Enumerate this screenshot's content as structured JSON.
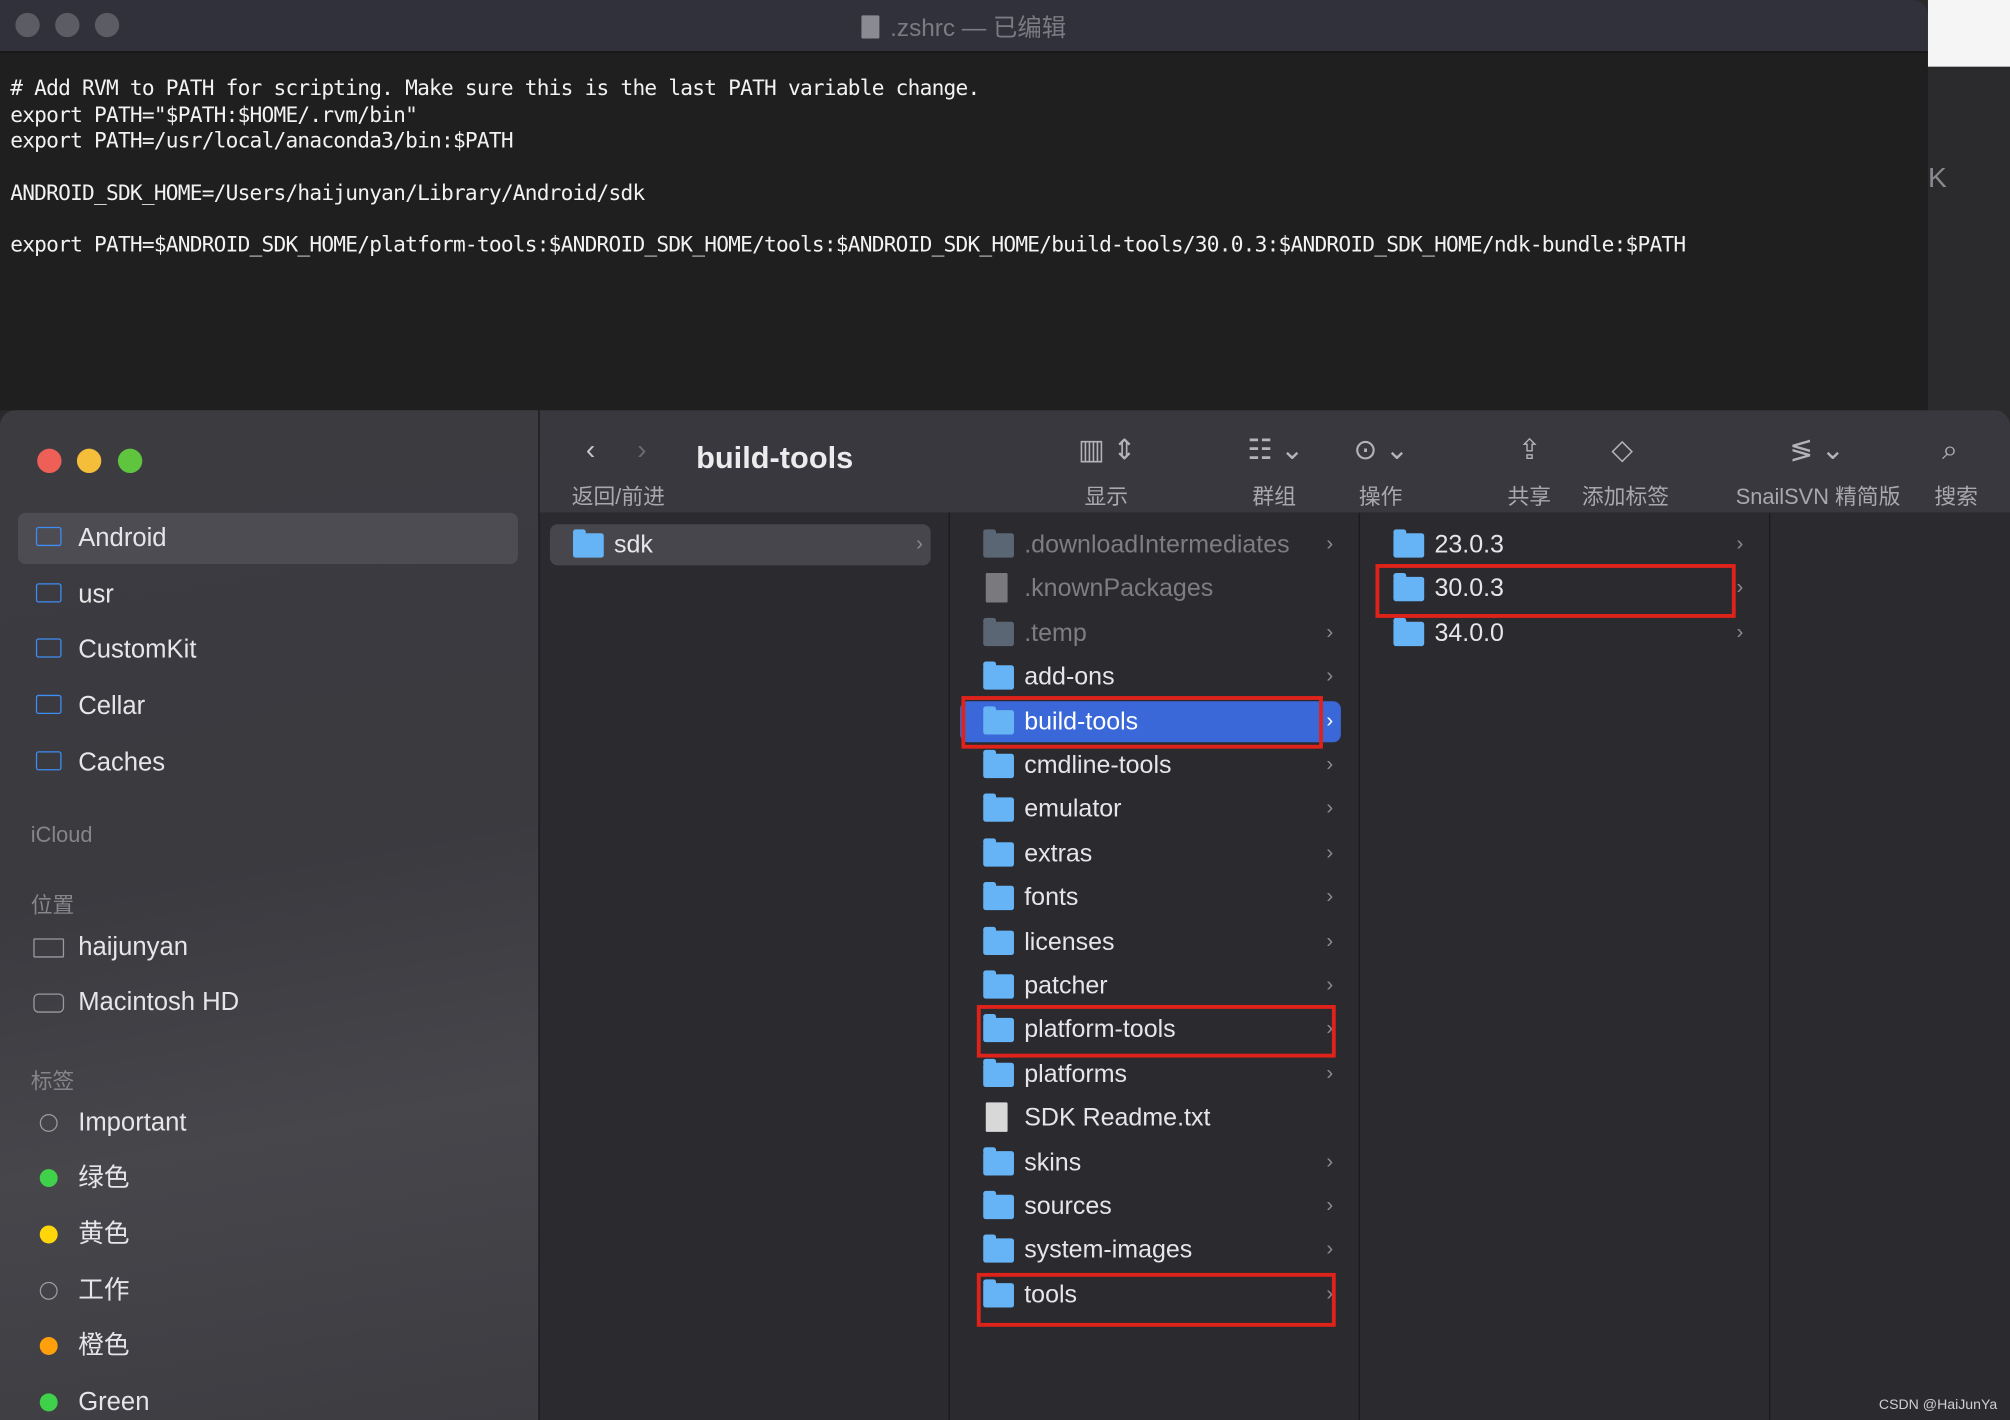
{
  "editor": {
    "title": ".zshrc",
    "title_status": "— 已编辑",
    "lines": [
      "# Add RVM to PATH for scripting. Make sure this is the last PATH variable change.",
      "export PATH=\"$PATH:$HOME/.rvm/bin\"",
      "export PATH=/usr/local/anaconda3/bin:$PATH",
      "ANDROID_SDK_HOME=/Users/haijunyan/Library/Android/sdk",
      "export PATH=$ANDROID_SDK_HOME/platform-tools:$ANDROID_SDK_HOME/tools:$ANDROID_SDK_HOME/build-tools/30.0.3:$ANDROID_SDK_HOME/ndk-bundle:$PATH"
    ],
    "background_fragment": "K"
  },
  "finder": {
    "toolbar": {
      "title": "build-tools",
      "back_forward_label": "返回/前进",
      "view_label": "显示",
      "group_label": "群组",
      "action_label": "操作",
      "share_label": "共享",
      "tag_label": "添加标签",
      "svn_label": "SnailSVN 精简版",
      "search_label": "搜索"
    },
    "sidebar": {
      "favorites": [
        "Android",
        "usr",
        "CustomKit",
        "Cellar",
        "Caches"
      ],
      "selected": "Android",
      "icloud_heading": "iCloud",
      "locations_heading": "位置",
      "locations": [
        "haijunyan",
        "Macintosh HD"
      ],
      "tags_heading": "标签",
      "tags": [
        {
          "label": "Important",
          "color": ""
        },
        {
          "label": "绿色",
          "color": "#3fd14a"
        },
        {
          "label": "黄色",
          "color": "#ffd60a"
        },
        {
          "label": "工作",
          "color": ""
        },
        {
          "label": "橙色",
          "color": "#ff9f0a"
        },
        {
          "label": "Green",
          "color": "#3fd14a"
        }
      ]
    },
    "columns": [
      [
        {
          "name": "sdk",
          "type": "folder",
          "state": "path"
        }
      ],
      [
        {
          "name": ".downloadIntermediates",
          "type": "folder",
          "hidden": true
        },
        {
          "name": ".knownPackages",
          "type": "file",
          "hidden": true
        },
        {
          "name": ".temp",
          "type": "folder",
          "hidden": true
        },
        {
          "name": "add-ons",
          "type": "folder"
        },
        {
          "name": "build-tools",
          "type": "folder",
          "state": "selected",
          "highlighted": true
        },
        {
          "name": "cmdline-tools",
          "type": "folder"
        },
        {
          "name": "emulator",
          "type": "folder"
        },
        {
          "name": "extras",
          "type": "folder"
        },
        {
          "name": "fonts",
          "type": "folder"
        },
        {
          "name": "licenses",
          "type": "folder"
        },
        {
          "name": "patcher",
          "type": "folder"
        },
        {
          "name": "platform-tools",
          "type": "folder",
          "highlighted": true
        },
        {
          "name": "platforms",
          "type": "folder"
        },
        {
          "name": "SDK Readme.txt",
          "type": "file"
        },
        {
          "name": "skins",
          "type": "folder"
        },
        {
          "name": "sources",
          "type": "folder"
        },
        {
          "name": "system-images",
          "type": "folder"
        },
        {
          "name": "tools",
          "type": "folder",
          "highlighted": true
        }
      ],
      [
        {
          "name": "23.0.3",
          "type": "folder"
        },
        {
          "name": "30.0.3",
          "type": "folder",
          "highlighted": true
        },
        {
          "name": "34.0.0",
          "type": "folder"
        }
      ]
    ],
    "colors": {
      "selection": "#3a68d8",
      "highlight_box": "#e0231a",
      "folder": "#66b3f5"
    }
  },
  "watermark": "CSDN @HaiJunYa"
}
